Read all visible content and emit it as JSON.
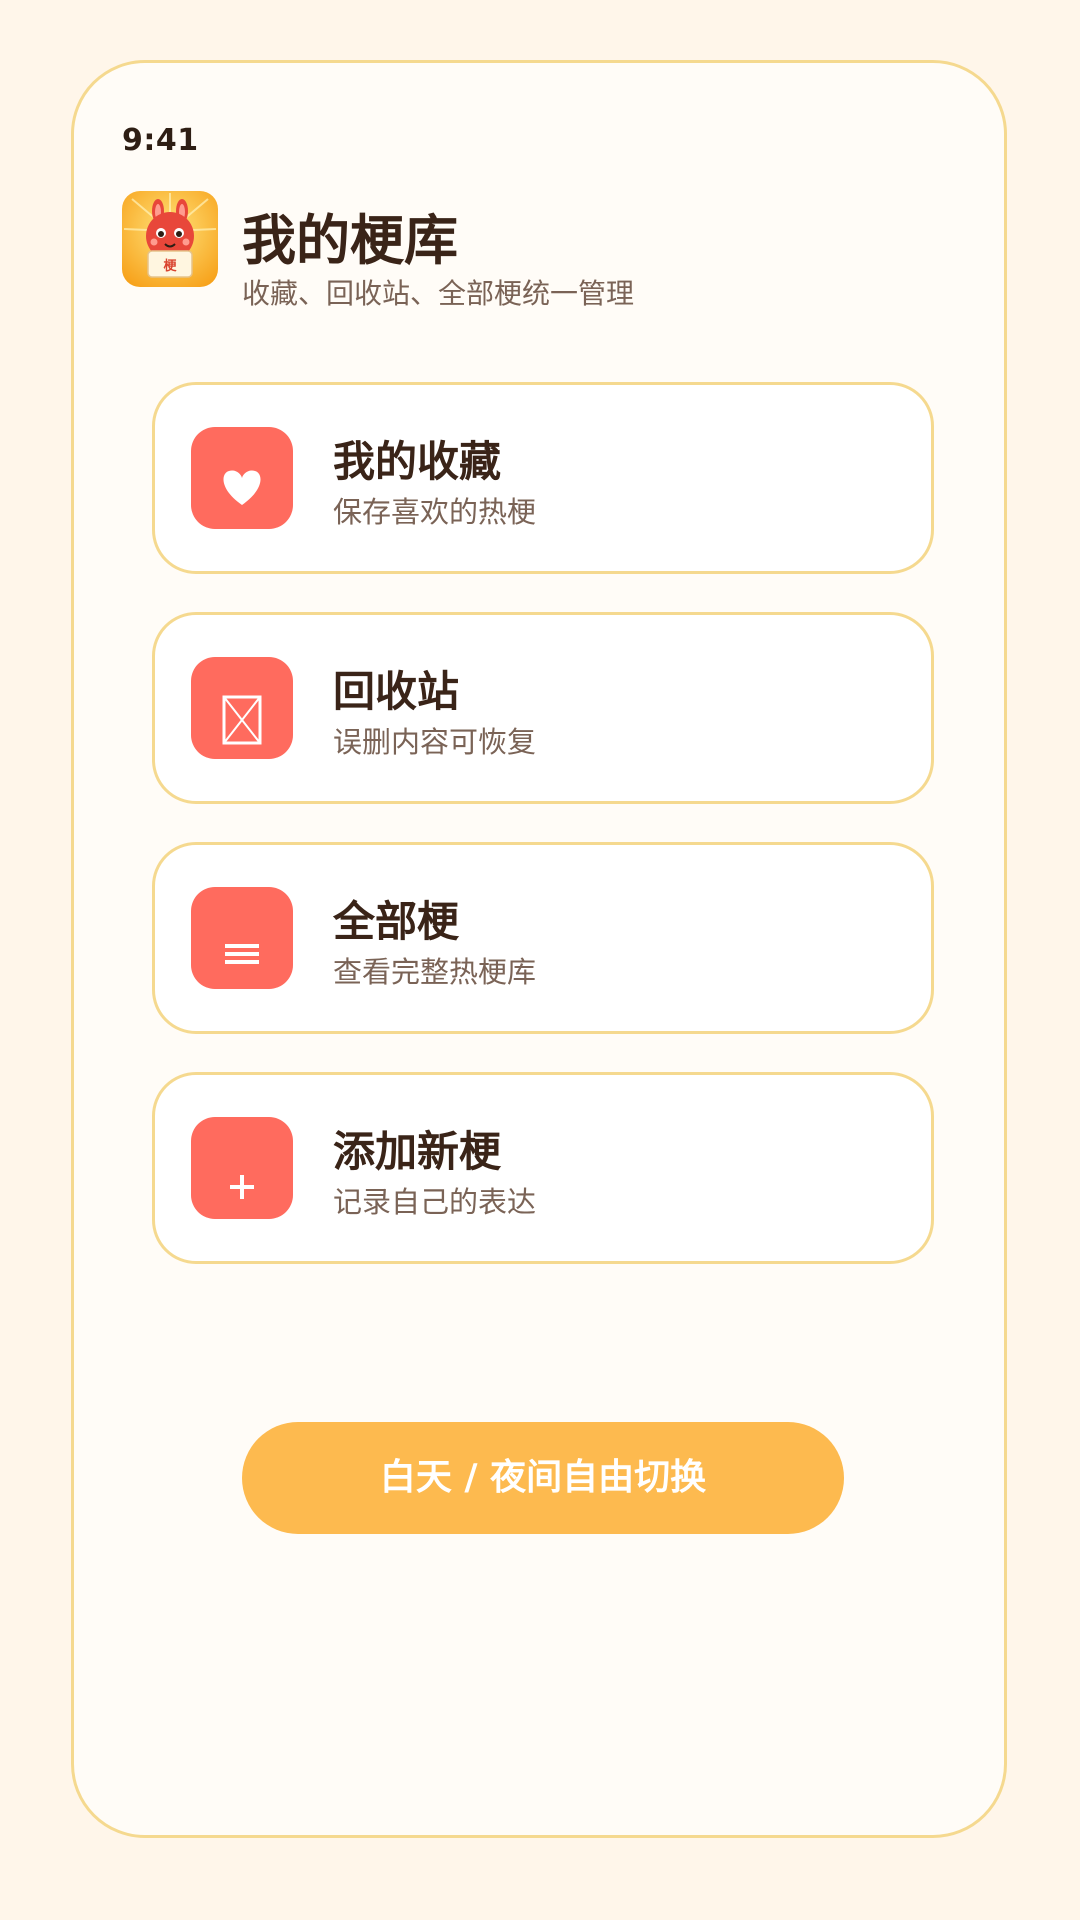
{
  "status": {
    "time": "9:41"
  },
  "header": {
    "title": "我的梗库",
    "subtitle": "收藏、回收站、全部梗统一管理",
    "app_icon": "rabbit-mascot-logo",
    "app_icon_text": "梗"
  },
  "menu": [
    {
      "title": "我的收藏",
      "desc": "保存喜欢的热梗",
      "icon": "heart-icon"
    },
    {
      "title": "回收站",
      "desc": "误删内容可恢复",
      "icon": "trash-box-icon"
    },
    {
      "title": "全部梗",
      "desc": "查看完整热梗库",
      "icon": "list-icon"
    },
    {
      "title": "添加新梗",
      "desc": "记录自己的表达",
      "icon": "plus-icon"
    }
  ],
  "toggle_button": {
    "label": "白天 / 夜间自由切换"
  },
  "colors": {
    "background": "#FFF6EA",
    "frame_border": "#F5D98F",
    "icon_tile": "#FF6B5E",
    "button": "#FDBA4F",
    "title_text": "#3A2418",
    "secondary_text": "#7A6356"
  }
}
